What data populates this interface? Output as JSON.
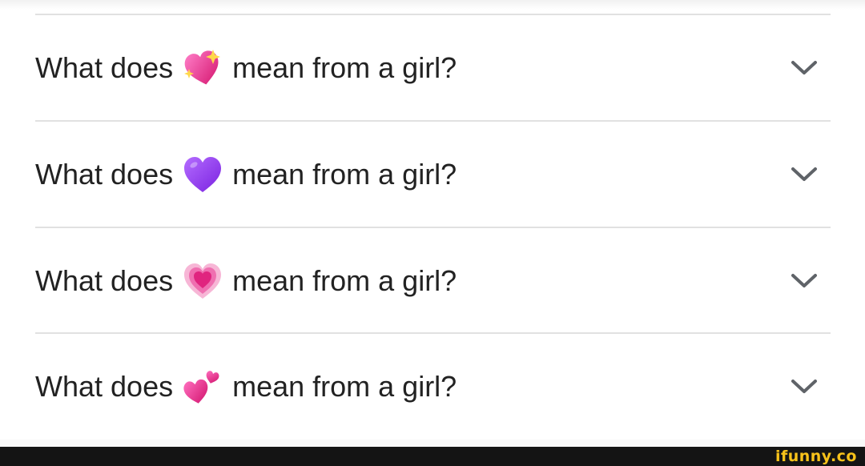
{
  "results": [
    {
      "prefix": "What does",
      "emoji": "sparkling-heart",
      "suffix": "mean from a girl?"
    },
    {
      "prefix": "What does",
      "emoji": "purple-heart",
      "suffix": "mean from a girl?"
    },
    {
      "prefix": "What does",
      "emoji": "heart-with-ribbon",
      "suffix": "mean from a girl?"
    },
    {
      "prefix": "What does",
      "emoji": "two-hearts",
      "suffix": "mean from a girl?"
    }
  ],
  "watermark": "ifunny.co",
  "colors": {
    "text": "#222222",
    "chevron": "#5f6368",
    "divider": "#e1e1e1",
    "watermark": "#f7c21a",
    "footer_bg": "#141414"
  }
}
